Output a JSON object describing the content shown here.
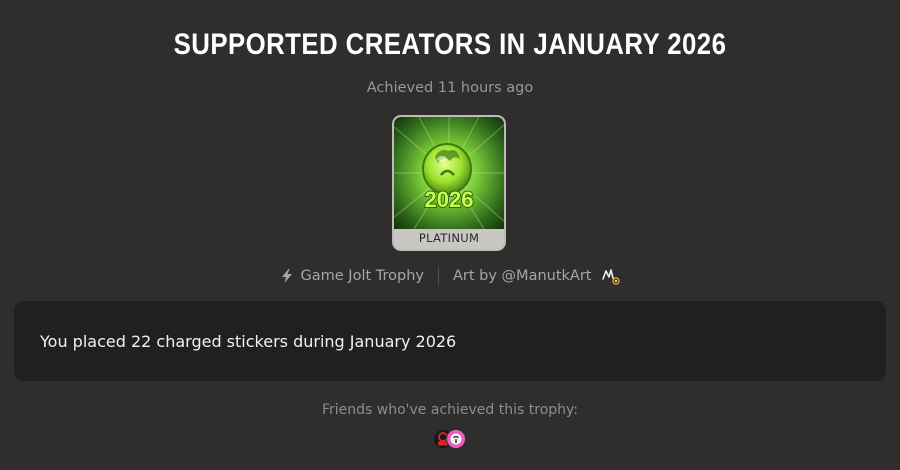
{
  "trophy": {
    "title": "SUPPORTED CREATORS IN JANUARY 2026",
    "achieved": "Achieved 11 hours ago",
    "image_text": "2026",
    "tier": "PLATINUM",
    "tier_color": "#c9c7c4",
    "source": "Game Jolt Trophy",
    "source_icon": "lightning-bolt-icon",
    "artist": "Art by @ManutkArt",
    "artist_icon": "artist-avatar-icon",
    "description": "You placed 22 charged stickers during January 2026"
  },
  "friends": {
    "label": "Friends who've achieved this trophy:",
    "avatars": [
      {
        "name": "friend-avatar-1",
        "color": "#d6272d"
      },
      {
        "name": "friend-avatar-2",
        "color": "#e95ec2"
      }
    ]
  },
  "colors": {
    "background": "#2f2e2d",
    "panel": "#212020",
    "accent_green": "#a8f23c"
  }
}
